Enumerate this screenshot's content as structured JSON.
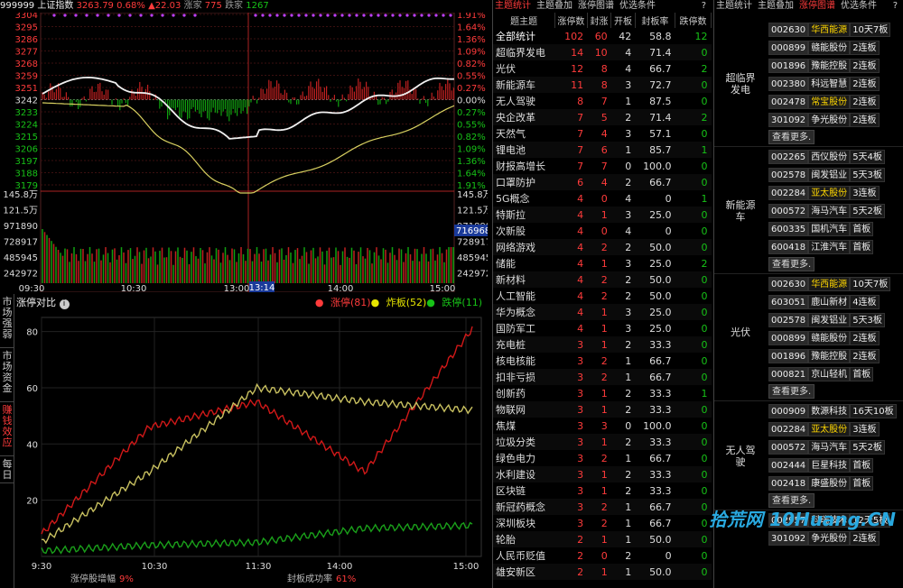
{
  "index_bar": {
    "code": "999999",
    "name": "上证指数",
    "price": "3263.79",
    "pct": "0.68%",
    "chg": "▲22.03",
    "up_label": "涨家",
    "up": "775",
    "down_label": "跌家",
    "down": "1267"
  },
  "price_axis": [
    "3304",
    "3295",
    "3286",
    "3277",
    "3268",
    "3259",
    "3251",
    "3242",
    "3233",
    "3224",
    "3215",
    "3206",
    "3197",
    "3188",
    "3179"
  ],
  "pct_axis": [
    "1.91%",
    "1.64%",
    "1.36%",
    "1.09%",
    "0.82%",
    "0.55%",
    "0.27%",
    "0.00%",
    "0.27%",
    "0.55%",
    "0.82%",
    "1.09%",
    "1.36%",
    "1.64%",
    "1.91%"
  ],
  "vol_axis": [
    "145.8万",
    "121.5万",
    "971890",
    "728917",
    "485945",
    "242972"
  ],
  "vol_highlight": "716968",
  "time_axis": [
    "09:30",
    "10:30",
    "13:00",
    "14:00",
    "15:00"
  ],
  "cursor_time": "13:14",
  "side_tabs": [
    "市场强弱",
    "市场资金",
    "赚钱效应",
    "每日"
  ],
  "compare": {
    "title": "涨停对比",
    "legend": [
      {
        "label": "涨停(81)",
        "color": "#ff3b3b"
      },
      {
        "label": "炸板(52)",
        "color": "#e6e600"
      },
      {
        "label": "跌停(11)",
        "color": "#17c217"
      }
    ],
    "y_ticks": [
      "80",
      "60",
      "40",
      "20"
    ],
    "x_ticks": [
      "9:30",
      "10:30",
      "11:30",
      "14:00",
      "15:00"
    ],
    "footer": [
      {
        "label": "涨停股增幅",
        "value": "9%"
      },
      {
        "label": "封板成功率",
        "value": "61%"
      }
    ]
  },
  "chart_data": {
    "type": "line",
    "title": "涨停对比",
    "x": [
      "9:30",
      "10:30",
      "11:30",
      "14:00",
      "15:00"
    ],
    "ylim": [
      0,
      85
    ],
    "series": [
      {
        "name": "涨停(81)",
        "values": [
          8,
          46,
          55,
          30,
          81
        ]
      },
      {
        "name": "炸板(52)",
        "values": [
          5,
          30,
          60,
          55,
          52
        ]
      },
      {
        "name": "跌停(11)",
        "values": [
          2,
          4,
          5,
          10,
          11
        ]
      }
    ]
  },
  "mid": {
    "tabs": [
      "主题统计",
      "主题叠加",
      "涨停图谱",
      "优选条件",
      "?"
    ],
    "headers": [
      "题主题",
      "涨停数",
      "封涨",
      "开板",
      "封板率",
      "跌停数"
    ],
    "rows": [
      [
        "全部统计",
        "102",
        "60",
        "42",
        "58.8",
        "12"
      ],
      [
        "超临界发电",
        "14",
        "10",
        "4",
        "71.4",
        "0"
      ],
      [
        "光伏",
        "12",
        "8",
        "4",
        "66.7",
        "2"
      ],
      [
        "新能源车",
        "11",
        "8",
        "3",
        "72.7",
        "0"
      ],
      [
        "无人驾驶",
        "8",
        "7",
        "1",
        "87.5",
        "0"
      ],
      [
        "央企改革",
        "7",
        "5",
        "2",
        "71.4",
        "2"
      ],
      [
        "天然气",
        "7",
        "4",
        "3",
        "57.1",
        "0"
      ],
      [
        "锂电池",
        "7",
        "6",
        "1",
        "85.7",
        "1"
      ],
      [
        "财报高增长",
        "7",
        "7",
        "0",
        "100.0",
        "0"
      ],
      [
        "口罩防护",
        "6",
        "4",
        "2",
        "66.7",
        "0"
      ],
      [
        "5G概念",
        "4",
        "0",
        "4",
        "0",
        "1"
      ],
      [
        "特斯拉",
        "4",
        "1",
        "3",
        "25.0",
        "0"
      ],
      [
        "次新股",
        "4",
        "0",
        "4",
        "0",
        "0"
      ],
      [
        "网络游戏",
        "4",
        "2",
        "2",
        "50.0",
        "0"
      ],
      [
        "储能",
        "4",
        "1",
        "3",
        "25.0",
        "2"
      ],
      [
        "新材料",
        "4",
        "2",
        "2",
        "50.0",
        "0"
      ],
      [
        "人工智能",
        "4",
        "2",
        "2",
        "50.0",
        "0"
      ],
      [
        "华为概念",
        "4",
        "1",
        "3",
        "25.0",
        "0"
      ],
      [
        "国防军工",
        "4",
        "1",
        "3",
        "25.0",
        "0"
      ],
      [
        "充电桩",
        "3",
        "1",
        "2",
        "33.3",
        "0"
      ],
      [
        "核电核能",
        "3",
        "2",
        "1",
        "66.7",
        "0"
      ],
      [
        "扣非亏损",
        "3",
        "2",
        "1",
        "66.7",
        "0"
      ],
      [
        "创新药",
        "3",
        "1",
        "2",
        "33.3",
        "1"
      ],
      [
        "物联网",
        "3",
        "1",
        "2",
        "33.3",
        "0"
      ],
      [
        "焦煤",
        "3",
        "3",
        "0",
        "100.0",
        "0"
      ],
      [
        "垃圾分类",
        "3",
        "1",
        "2",
        "33.3",
        "0"
      ],
      [
        "绿色电力",
        "3",
        "2",
        "1",
        "66.7",
        "0"
      ],
      [
        "水利建设",
        "3",
        "1",
        "2",
        "33.3",
        "0"
      ],
      [
        "区块链",
        "3",
        "1",
        "2",
        "33.3",
        "0"
      ],
      [
        "新冠药概念",
        "3",
        "2",
        "1",
        "66.7",
        "0"
      ],
      [
        "深圳板块",
        "3",
        "2",
        "1",
        "66.7",
        "0"
      ],
      [
        "轮胎",
        "2",
        "1",
        "1",
        "50.0",
        "0"
      ],
      [
        "人民币贬值",
        "2",
        "0",
        "2",
        "0",
        "0"
      ],
      [
        "雄安新区",
        "2",
        "1",
        "1",
        "50.0",
        "0"
      ]
    ]
  },
  "right": {
    "tabs": [
      "主题统计",
      "主题叠加",
      "涨停图谱",
      "优选条件",
      "?"
    ],
    "groups": [
      {
        "label": "超临界发电",
        "stocks": [
          [
            "002630",
            "华西能源",
            "10天7板",
            true
          ],
          [
            "000899",
            "赣能股份",
            "2连板",
            false
          ],
          [
            "001896",
            "豫能控股",
            "2连板",
            false
          ],
          [
            "002380",
            "科远智慧",
            "2连板",
            false
          ],
          [
            "002478",
            "常宝股份",
            "2连板",
            true
          ],
          [
            "301092",
            "争光股份",
            "2连板",
            false
          ]
        ]
      },
      {
        "label": "新能源车",
        "stocks": [
          [
            "002265",
            "西仪股份",
            "5天4板",
            false
          ],
          [
            "002578",
            "闽发铝业",
            "5天3板",
            false
          ],
          [
            "002284",
            "亚太股份",
            "3连板",
            true
          ],
          [
            "000572",
            "海马汽车",
            "5天2板",
            false
          ],
          [
            "600335",
            "国机汽车",
            "首板",
            false
          ],
          [
            "600418",
            "江淮汽车",
            "首板",
            false
          ]
        ]
      },
      {
        "label": "光伏",
        "stocks": [
          [
            "002630",
            "华西能源",
            "10天7板",
            true
          ],
          [
            "603051",
            "鹿山新材",
            "4连板",
            false
          ],
          [
            "002578",
            "闽发铝业",
            "5天3板",
            false
          ],
          [
            "000899",
            "赣能股份",
            "2连板",
            false
          ],
          [
            "001896",
            "豫能控股",
            "2连板",
            false
          ],
          [
            "000821",
            "京山轻机",
            "首板",
            false
          ]
        ]
      },
      {
        "label": "无人驾驶",
        "stocks": [
          [
            "000909",
            "数源科技",
            "16天10板",
            false
          ],
          [
            "002284",
            "亚太股份",
            "3连板",
            true
          ],
          [
            "000572",
            "海马汽车",
            "5天2板",
            false
          ],
          [
            "002444",
            "巨星科技",
            "首板",
            false
          ],
          [
            "002418",
            "康盛股份",
            "首板",
            false
          ]
        ]
      }
    ],
    "more_label": "查看更多.",
    "tail": [
      [
        "002957",
        "科瑞技术",
        "12天5板",
        false
      ],
      [
        "301092",
        "争光股份",
        "2连板",
        false
      ]
    ]
  },
  "watermark": "拾荒网 10Huang.CN"
}
